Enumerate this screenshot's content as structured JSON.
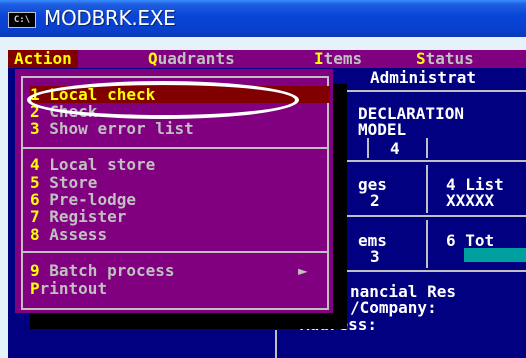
{
  "window": {
    "icon_text": "C:\\",
    "title": "MODBRK.EXE"
  },
  "menubar": [
    {
      "hot": "A",
      "rest": "ction"
    },
    {
      "hot": "Q",
      "rest": "uadrants"
    },
    {
      "hot": "I",
      "rest": "tems"
    },
    {
      "hot": "S",
      "rest": "tatus"
    }
  ],
  "background": {
    "administration": "Administrat",
    "declaration": "DECLARATION",
    "model": "MODEL",
    "model_value": "4",
    "ges": "ges",
    "ges_value": "2",
    "list_label": "4 List",
    "list_value": "XXXXX",
    "ems": "ems",
    "ems_value": "3",
    "tot_label": "6 Tot",
    "financial": "nancial Res",
    "company": "/Company:",
    "address": "Address:"
  },
  "action_menu": {
    "items": [
      {
        "num": "1",
        "label": " Local check",
        "selected": true
      },
      {
        "num": "2",
        "label": " Check"
      },
      {
        "num": "3",
        "label": " Show error list"
      },
      {
        "num": "4",
        "label": " Local store"
      },
      {
        "num": "5",
        "label": " Store"
      },
      {
        "num": "6",
        "label": " Pre-lodge"
      },
      {
        "num": "7",
        "label": " Register"
      },
      {
        "num": "8",
        "label": " Assess"
      },
      {
        "num": "9",
        "label": " Batch process",
        "submenu_arrow": "►"
      },
      {
        "num": "P",
        "label": "rintout"
      }
    ]
  },
  "colors": {
    "titlebar": "#0a46d8",
    "console_bg": "#000080",
    "menu_bg": "#800080",
    "selected_bg": "#800000",
    "hotkey": "#ffff00",
    "menu_text": "#c0c0c0"
  }
}
